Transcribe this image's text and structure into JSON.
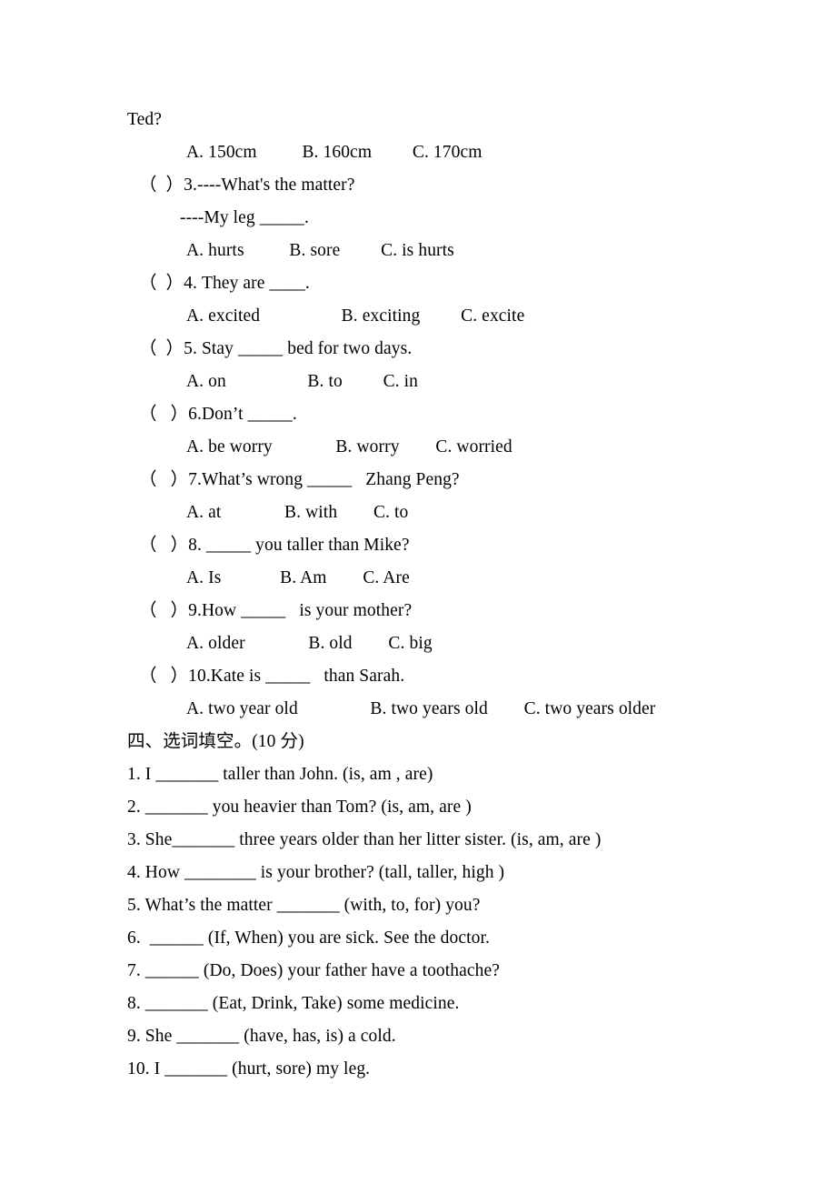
{
  "document": {
    "type": "worksheet",
    "language": "en-CN",
    "background_color": "#ffffff",
    "text_color": "#000000"
  },
  "orphan_text": "Ted?",
  "multiple_choice": {
    "carryover_options": "A. 150cm          B. 160cm         C. 170cm",
    "questions": [
      {
        "marker": "（  ）",
        "number": "3.",
        "stem": "（  ）3.----What's the matter?",
        "continuation": "----My leg _____.",
        "options": "A. hurts          B. sore         C. is hurts"
      },
      {
        "marker": "（  ）",
        "number": "4.",
        "stem": "（  ）4. They are ____.",
        "continuation": null,
        "options": "A. excited                  B. exciting         C. excite"
      },
      {
        "marker": "（  ）",
        "number": "5.",
        "stem": "（  ）5. Stay _____ bed for two days.",
        "continuation": null,
        "options": "A. on                  B. to         C. in"
      },
      {
        "marker": "（   ）",
        "number": "6.",
        "stem": "（   ）6.Don’t _____.",
        "continuation": null,
        "options": "A. be worry              B. worry        C. worried"
      },
      {
        "marker": "（   ）",
        "number": "7.",
        "stem": "（   ）7.What’s wrong _____   Zhang Peng?",
        "continuation": null,
        "options": "A. at              B. with        C. to"
      },
      {
        "marker": "（   ）",
        "number": "8.",
        "stem": "（   ）8. _____ you taller than Mike?",
        "continuation": null,
        "options": "A. Is             B. Am        C. Are"
      },
      {
        "marker": "（   ）",
        "number": "9.",
        "stem": "（   ）9.How _____   is your mother?",
        "continuation": null,
        "options": "A. older              B. old        C. big"
      },
      {
        "marker": "（   ）",
        "number": "10.",
        "stem": "（   ）10.Kate is _____   than Sarah.",
        "continuation": null,
        "options": "A. two year old                B. two years old        C. two years older"
      }
    ]
  },
  "section_four": {
    "heading": "四、选词填空。(10 分)",
    "number_label": "四",
    "title": "选词填空",
    "points": "(10 分)",
    "items": [
      "1. I _______ taller than John. (is, am , are)",
      "2. _______ you heavier than Tom? (is, am, are )",
      "3. She_______ three years older than her litter sister. (is, am, are )",
      "4. How ________ is your brother? (tall, taller, high )",
      "5. What’s the matter _______ (with, to, for) you?",
      "6.  ______ (If, When) you are sick. See the doctor.",
      "7. ______ (Do, Does) your father have a toothache?",
      "8. _______ (Eat, Drink, Take) some medicine.",
      "9. She _______ (have, has, is) a cold.",
      "10. I _______ (hurt, sore) my leg."
    ]
  }
}
